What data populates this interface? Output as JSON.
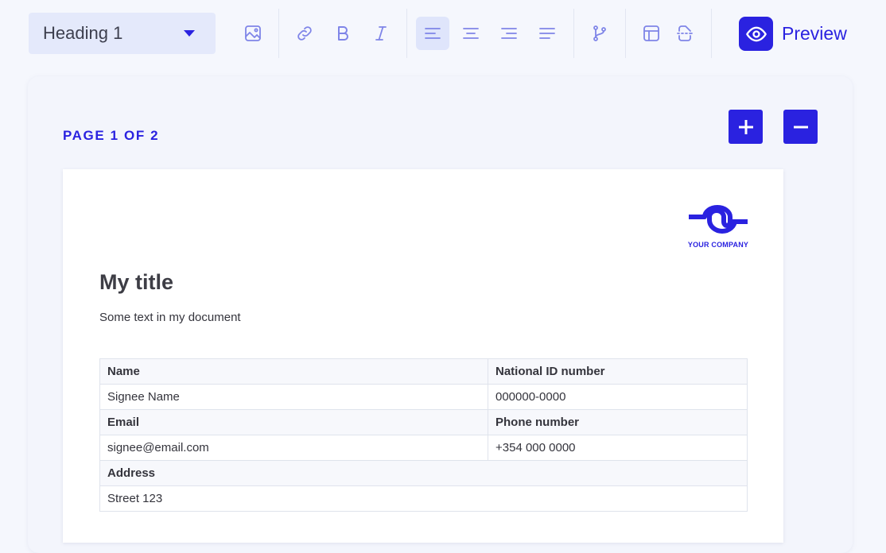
{
  "toolbar": {
    "heading_select": {
      "value": "Heading 1"
    },
    "buttons": [
      {
        "name": "insert-image-button",
        "icon": "image-icon"
      },
      {
        "name": "insert-link-button",
        "icon": "link-icon"
      },
      {
        "name": "bold-button",
        "icon": "bold-icon"
      },
      {
        "name": "italic-button",
        "icon": "italic-icon"
      },
      {
        "name": "align-left-button",
        "icon": "align-left-icon",
        "active": true
      },
      {
        "name": "align-center-button",
        "icon": "align-center-icon"
      },
      {
        "name": "align-right-button",
        "icon": "align-right-icon"
      },
      {
        "name": "justify-button",
        "icon": "align-justify-icon"
      },
      {
        "name": "insert-variable-button",
        "icon": "git-branch-icon"
      },
      {
        "name": "insert-table-button",
        "icon": "table-icon"
      },
      {
        "name": "page-break-button",
        "icon": "page-break-icon"
      }
    ],
    "preview": {
      "label": "Preview",
      "icon": "eye-icon"
    }
  },
  "page": {
    "indicator": "PAGE 1 OF 2",
    "add_icon": "plus-icon",
    "remove_icon": "minus-icon"
  },
  "document": {
    "logo": {
      "icon": "company-logo-icon",
      "text": "YOUR COMPANY"
    },
    "title": "My title",
    "body": "Some text in my document",
    "table": {
      "rows": [
        {
          "header": true,
          "cells": [
            "Name",
            "National ID number"
          ]
        },
        {
          "header": false,
          "cells": [
            "Signee Name",
            "000000-0000"
          ]
        },
        {
          "header": true,
          "cells": [
            "Email",
            "Phone number"
          ]
        },
        {
          "header": false,
          "cells": [
            "signee@email.com",
            "+354 000 0000"
          ]
        },
        {
          "header": true,
          "cells": [
            "Address"
          ]
        },
        {
          "header": false,
          "cells": [
            "Street 123"
          ]
        }
      ]
    }
  },
  "colors": {
    "accent": "#2a22e0",
    "icon": "#7f85e8",
    "background": "#f5f7fd",
    "select_bg": "#e4e9fb"
  }
}
